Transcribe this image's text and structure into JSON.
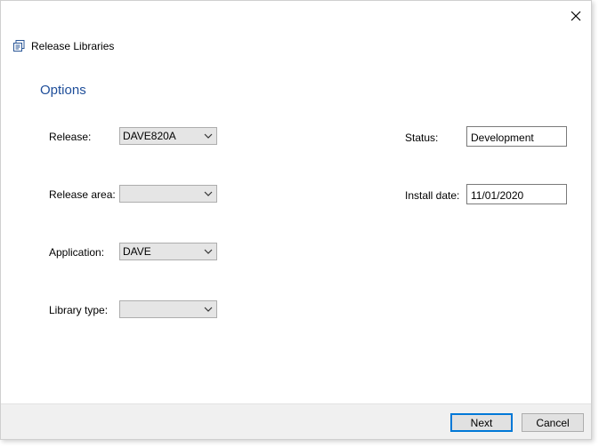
{
  "window": {
    "title": "Release Libraries",
    "close_glyph": "✕"
  },
  "section": {
    "heading": "Options",
    "heading_color": "#1f4e9a"
  },
  "fields": {
    "release": {
      "label": "Release:",
      "value": "DAVE820A"
    },
    "release_area": {
      "label": "Release area:",
      "value": ""
    },
    "application": {
      "label": "Application:",
      "value": "DAVE"
    },
    "library_type": {
      "label": "Library type:",
      "value": ""
    },
    "status": {
      "label": "Status:",
      "value": "Development"
    },
    "install_date": {
      "label": "Install date:",
      "value": "11/01/2020"
    }
  },
  "buttons": {
    "next": "Next",
    "cancel": "Cancel"
  },
  "colors": {
    "accent": "#0078d7",
    "combo_bg": "#e5e5e5",
    "footer_bg": "#f0f0f0"
  },
  "icons": {
    "app": "release-libraries-icon",
    "close": "close-icon",
    "dropdown": "chevron-down-icon"
  }
}
